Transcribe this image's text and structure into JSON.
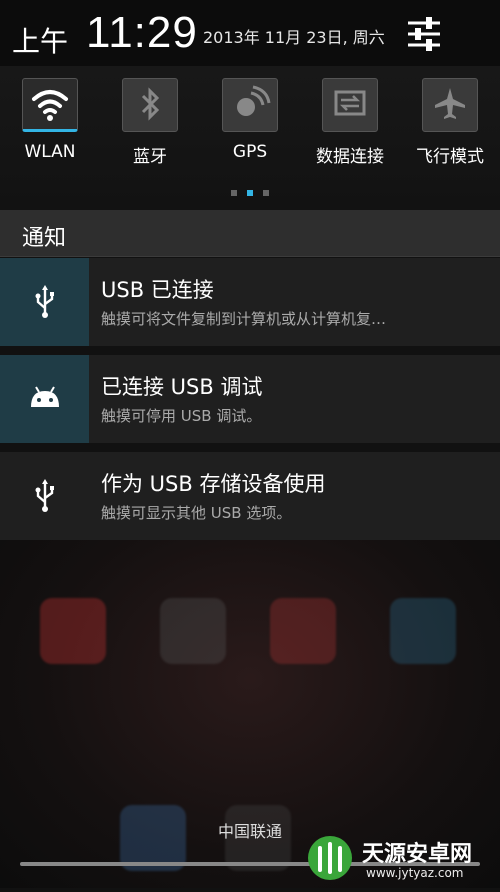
{
  "header": {
    "ampm": "上午",
    "time": "11:29",
    "date": "2013年 11月 23日, 周六"
  },
  "toggles": [
    {
      "label": "WLAN",
      "icon": "wifi-icon",
      "active": true
    },
    {
      "label": "蓝牙",
      "icon": "bluetooth-icon",
      "active": false
    },
    {
      "label": "GPS",
      "icon": "gps-icon",
      "active": false
    },
    {
      "label": "数据连接",
      "icon": "data-connection-icon",
      "active": false
    },
    {
      "label": "飞行模式",
      "icon": "airplane-icon",
      "active": false
    }
  ],
  "notifications_header": "通知",
  "notifications": [
    {
      "title": "USB 已连接",
      "subtitle": "触摸可将文件复制到计算机或从计算机复…",
      "icon": "usb-icon"
    },
    {
      "title": "已连接 USB 调试",
      "subtitle": "触摸可停用 USB 调试。",
      "icon": "android-icon"
    },
    {
      "title": "作为 USB 存储设备使用",
      "subtitle": "触摸可显示其他 USB 选项。",
      "icon": "usb-icon"
    }
  ],
  "carrier": "中国联通",
  "watermark": {
    "brand": "天源安卓网",
    "url": "www.jytyaz.com"
  },
  "colors": {
    "accent": "#33b5e5",
    "icon_tile": "#1f3c46",
    "panel": "#1f1f1f"
  }
}
